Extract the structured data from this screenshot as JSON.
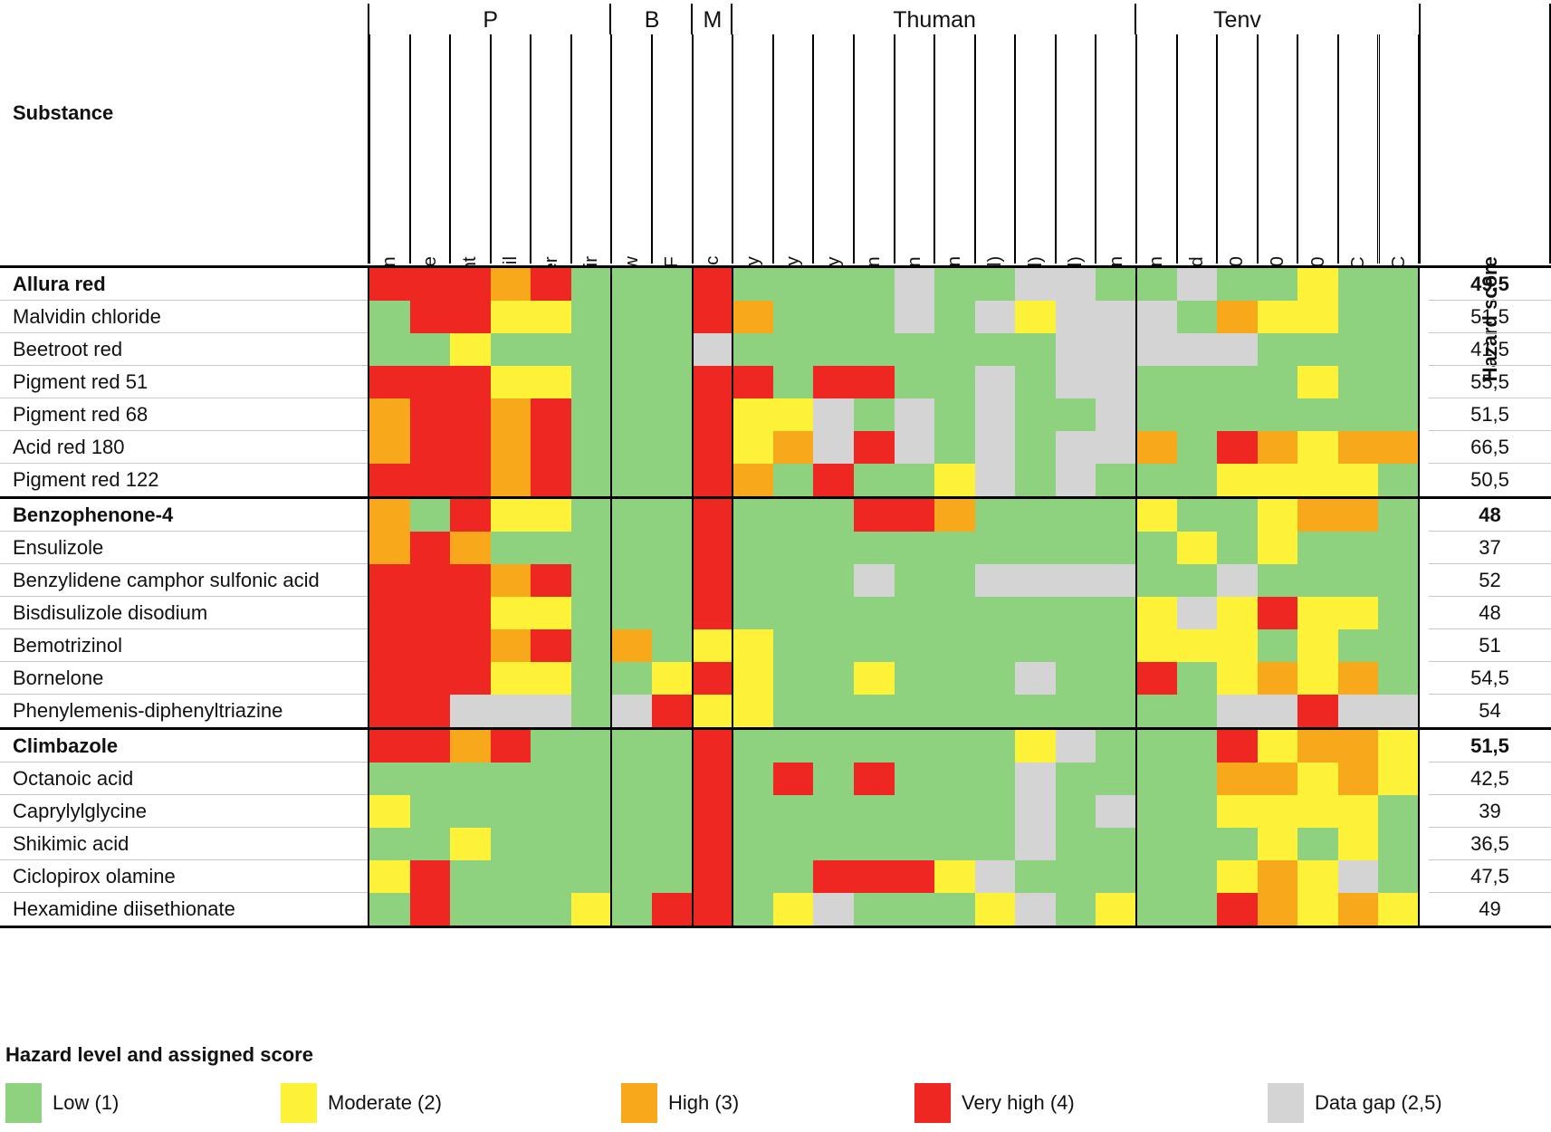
{
  "table": {
    "row_header_label": "Substance",
    "score_header_label": "Hazard score",
    "column_groups": [
      {
        "label": "P",
        "span": 6
      },
      {
        "label": "B",
        "span": 2
      },
      {
        "label": "M",
        "span": 1
      },
      {
        "label": "Thuman",
        "span": 10
      },
      {
        "label": "Tenv",
        "span": 5
      }
    ],
    "columns": [
      "Anaerobic degradation",
      "Readily-biodegradable",
      "Half-life sediment",
      "Half-life soil",
      "Half-life water",
      "Half-life air",
      "LogKow",
      "LogBCF",
      "LogKoc",
      "Carcinogenicity",
      "Mutagenicity",
      "Teratogenicity",
      "Skin sensitization",
      "Skin irritation",
      "Eye irritation",
      "Acute tox. (oral)",
      "Acute tox. (dermal)",
      "STOT-RE (oral)",
      "Androgen",
      "Estrogen",
      "Thyroid",
      "Algae LC50",
      "Daphnia LC50",
      "Fish LC50",
      "Daphnia NOEC",
      "Fish NOEC"
    ],
    "groups": [
      {
        "rows": [
          {
            "name": "Allura red",
            "bold": true,
            "score": "49,5",
            "values": [
              "vhigh",
              "vhigh",
              "vhigh",
              "high",
              "vhigh",
              "low",
              "low",
              "low",
              "vhigh",
              "low",
              "low",
              "low",
              "low",
              "gap",
              "low",
              "low",
              "gap",
              "gap",
              "low",
              "low",
              "gap",
              "low",
              "low",
              "mod",
              "low",
              "low"
            ]
          },
          {
            "name": "Malvidin chloride",
            "bold": false,
            "score": "51,5",
            "values": [
              "low",
              "vhigh",
              "vhigh",
              "mod",
              "mod",
              "low",
              "low",
              "low",
              "vhigh",
              "high",
              "low",
              "low",
              "low",
              "gap",
              "low",
              "gap",
              "mod",
              "gap",
              "gap",
              "gap",
              "low",
              "high",
              "mod",
              "mod",
              "low",
              "low"
            ]
          },
          {
            "name": "Beetroot red",
            "bold": false,
            "score": "41,5",
            "values": [
              "low",
              "low",
              "mod",
              "low",
              "low",
              "low",
              "low",
              "low",
              "gap",
              "low",
              "low",
              "low",
              "low",
              "low",
              "low",
              "low",
              "low",
              "gap",
              "gap",
              "gap",
              "gap",
              "gap",
              "low",
              "low",
              "low",
              "low"
            ]
          },
          {
            "name": "Pigment red 51",
            "bold": false,
            "score": "55,5",
            "values": [
              "vhigh",
              "vhigh",
              "vhigh",
              "mod",
              "mod",
              "low",
              "low",
              "low",
              "vhigh",
              "vhigh",
              "low",
              "vhigh",
              "vhigh",
              "low",
              "low",
              "gap",
              "low",
              "gap",
              "gap",
              "low",
              "low",
              "low",
              "low",
              "mod",
              "low",
              "low"
            ]
          },
          {
            "name": "Pigment red 68",
            "bold": false,
            "score": "51,5",
            "values": [
              "high",
              "vhigh",
              "vhigh",
              "high",
              "vhigh",
              "low",
              "low",
              "low",
              "vhigh",
              "mod",
              "mod",
              "gap",
              "low",
              "gap",
              "low",
              "gap",
              "low",
              "low",
              "gap",
              "low",
              "low",
              "low",
              "low",
              "low",
              "low",
              "low"
            ]
          },
          {
            "name": "Acid red 180",
            "bold": false,
            "score": "66,5",
            "values": [
              "high",
              "vhigh",
              "vhigh",
              "high",
              "vhigh",
              "low",
              "low",
              "low",
              "vhigh",
              "mod",
              "high",
              "gap",
              "vhigh",
              "gap",
              "low",
              "gap",
              "low",
              "gap",
              "gap",
              "high",
              "low",
              "vhigh",
              "high",
              "mod",
              "high",
              "high"
            ]
          },
          {
            "name": "Pigment red 122",
            "bold": false,
            "score": "50,5",
            "values": [
              "vhigh",
              "vhigh",
              "vhigh",
              "high",
              "vhigh",
              "low",
              "low",
              "low",
              "vhigh",
              "high",
              "low",
              "vhigh",
              "low",
              "low",
              "mod",
              "gap",
              "low",
              "gap",
              "low",
              "low",
              "low",
              "mod",
              "mod",
              "mod",
              "mod",
              "low"
            ]
          }
        ]
      },
      {
        "rows": [
          {
            "name": "Benzophenone-4",
            "bold": true,
            "score": "48",
            "values": [
              "high",
              "low",
              "vhigh",
              "mod",
              "mod",
              "low",
              "low",
              "low",
              "vhigh",
              "low",
              "low",
              "low",
              "vhigh",
              "vhigh",
              "high",
              "low",
              "low",
              "low",
              "low",
              "mod",
              "low",
              "low",
              "mod",
              "high",
              "high",
              "low"
            ]
          },
          {
            "name": "Ensulizole",
            "bold": false,
            "score": "37",
            "values": [
              "high",
              "vhigh",
              "high",
              "low",
              "low",
              "low",
              "low",
              "low",
              "vhigh",
              "low",
              "low",
              "low",
              "low",
              "low",
              "low",
              "low",
              "low",
              "low",
              "low",
              "low",
              "mod",
              "low",
              "mod",
              "low",
              "low",
              "low"
            ]
          },
          {
            "name": "Benzylidene camphor sulfonic acid",
            "bold": false,
            "score": "52",
            "values": [
              "vhigh",
              "vhigh",
              "vhigh",
              "high",
              "vhigh",
              "low",
              "low",
              "low",
              "vhigh",
              "low",
              "low",
              "low",
              "gap",
              "low",
              "low",
              "gap",
              "gap",
              "gap",
              "gap",
              "low",
              "low",
              "gap",
              "low",
              "low",
              "low",
              "low"
            ]
          },
          {
            "name": "Bisdisulizole disodium",
            "bold": false,
            "score": "48",
            "values": [
              "vhigh",
              "vhigh",
              "vhigh",
              "mod",
              "mod",
              "low",
              "low",
              "low",
              "vhigh",
              "low",
              "low",
              "low",
              "low",
              "low",
              "low",
              "low",
              "low",
              "low",
              "low",
              "mod",
              "gap",
              "mod",
              "vhigh",
              "mod",
              "mod",
              "low"
            ]
          },
          {
            "name": "Bemotrizinol",
            "bold": false,
            "score": "51",
            "values": [
              "vhigh",
              "vhigh",
              "vhigh",
              "high",
              "vhigh",
              "low",
              "high",
              "low",
              "mod",
              "mod",
              "low",
              "low",
              "low",
              "low",
              "low",
              "low",
              "low",
              "low",
              "low",
              "mod",
              "mod",
              "mod",
              "low",
              "mod",
              "low",
              "low"
            ]
          },
          {
            "name": "Bornelone",
            "bold": false,
            "score": "54,5",
            "values": [
              "vhigh",
              "vhigh",
              "vhigh",
              "mod",
              "mod",
              "low",
              "low",
              "mod",
              "vhigh",
              "mod",
              "low",
              "low",
              "mod",
              "low",
              "low",
              "low",
              "gap",
              "low",
              "low",
              "vhigh",
              "low",
              "mod",
              "high",
              "mod",
              "high",
              "low"
            ]
          },
          {
            "name": "Phenylemenis-diphenyltriazine",
            "bold": false,
            "score": "54",
            "values": [
              "vhigh",
              "vhigh",
              "gap",
              "gap",
              "gap",
              "low",
              "gap",
              "vhigh",
              "mod",
              "mod",
              "low",
              "low",
              "low",
              "low",
              "low",
              "low",
              "low",
              "low",
              "low",
              "low",
              "low",
              "gap",
              "gap",
              "vhigh",
              "gap",
              "gap"
            ]
          }
        ]
      },
      {
        "rows": [
          {
            "name": "Climbazole",
            "bold": true,
            "score": "51,5",
            "values": [
              "vhigh",
              "vhigh",
              "high",
              "vhigh",
              "low",
              "low",
              "low",
              "low",
              "vhigh",
              "low",
              "low",
              "low",
              "low",
              "low",
              "low",
              "low",
              "mod",
              "gap",
              "low",
              "low",
              "low",
              "vhigh",
              "mod",
              "high",
              "high",
              "mod"
            ]
          },
          {
            "name": "Octanoic acid",
            "bold": false,
            "score": "42,5",
            "values": [
              "low",
              "low",
              "low",
              "low",
              "low",
              "low",
              "low",
              "low",
              "vhigh",
              "low",
              "vhigh",
              "low",
              "vhigh",
              "low",
              "low",
              "low",
              "gap",
              "low",
              "low",
              "low",
              "low",
              "high",
              "high",
              "mod",
              "high",
              "mod"
            ]
          },
          {
            "name": "Caprylylglycine",
            "bold": false,
            "score": "39",
            "values": [
              "mod",
              "low",
              "low",
              "low",
              "low",
              "low",
              "low",
              "low",
              "vhigh",
              "low",
              "low",
              "low",
              "low",
              "low",
              "low",
              "low",
              "gap",
              "low",
              "gap",
              "low",
              "low",
              "mod",
              "mod",
              "mod",
              "mod",
              "low"
            ]
          },
          {
            "name": "Shikimic acid",
            "bold": false,
            "score": "36,5",
            "values": [
              "low",
              "low",
              "mod",
              "low",
              "low",
              "low",
              "low",
              "low",
              "vhigh",
              "low",
              "low",
              "low",
              "low",
              "low",
              "low",
              "low",
              "gap",
              "low",
              "low",
              "low",
              "low",
              "low",
              "mod",
              "low",
              "mod",
              "low"
            ]
          },
          {
            "name": "Ciclopirox olamine",
            "bold": false,
            "score": "47,5",
            "values": [
              "mod",
              "vhigh",
              "low",
              "low",
              "low",
              "low",
              "low",
              "low",
              "vhigh",
              "low",
              "low",
              "vhigh",
              "vhigh",
              "vhigh",
              "mod",
              "gap",
              "low",
              "low",
              "low",
              "low",
              "low",
              "mod",
              "high",
              "mod",
              "gap",
              "low"
            ]
          },
          {
            "name": "Hexamidine diisethionate",
            "bold": false,
            "score": "49",
            "values": [
              "low",
              "vhigh",
              "low",
              "low",
              "low",
              "mod",
              "low",
              "vhigh",
              "vhigh",
              "low",
              "mod",
              "gap",
              "low",
              "low",
              "low",
              "mod",
              "gap",
              "low",
              "mod",
              "low",
              "low",
              "vhigh",
              "high",
              "mod",
              "high",
              "mod"
            ]
          }
        ]
      }
    ]
  },
  "legend": {
    "title": "Hazard level and assigned score",
    "items": [
      {
        "label": "Low (1)",
        "key": "low"
      },
      {
        "label": "Moderate (2)",
        "key": "mod"
      },
      {
        "label": "High (3)",
        "key": "high"
      },
      {
        "label": "Very high (4)",
        "key": "vhigh"
      },
      {
        "label": "Data gap (2,5)",
        "key": "gap"
      }
    ]
  },
  "colors": {
    "low": "#8ed27f",
    "mod": "#fdf238",
    "high": "#f7a81b",
    "vhigh": "#ee2722",
    "gap": "#d4d4d4"
  }
}
